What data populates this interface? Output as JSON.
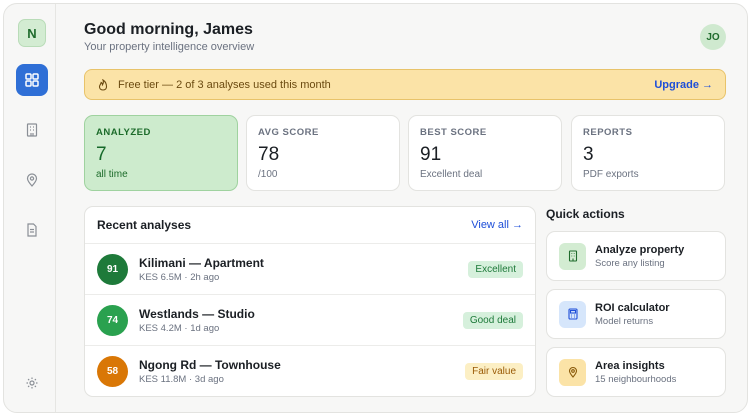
{
  "sidebar": {
    "logo_letter": "N",
    "items": [
      {
        "icon": "dashboard-icon",
        "active": true
      },
      {
        "icon": "building-icon",
        "active": false
      },
      {
        "icon": "map-pin-icon",
        "active": false
      },
      {
        "icon": "document-icon",
        "active": false
      }
    ],
    "settings_icon": "gear-icon"
  },
  "header": {
    "greeting": "Good morning, James",
    "subtitle": "Your property intelligence overview",
    "avatar_initials": "JO"
  },
  "banner": {
    "text": "Free tier — 2 of 3 analyses used this month",
    "action": "Upgrade →"
  },
  "stats": [
    {
      "label": "ANALYZED",
      "value": "7",
      "sub": "all time"
    },
    {
      "label": "AVG SCORE",
      "value": "78",
      "sub": "/100"
    },
    {
      "label": "BEST SCORE",
      "value": "91",
      "sub": "Excellent deal"
    },
    {
      "label": "REPORTS",
      "value": "3",
      "sub": "PDF exports"
    }
  ],
  "recent": {
    "title": "Recent analyses",
    "view_all": "View all →",
    "rows": [
      {
        "score": "91",
        "name": "Kilimani — Apartment",
        "meta": "KES 6.5M · 2h ago",
        "badge": "Excellent",
        "score_color": "#1e7a3a",
        "badge_bg": "#d6f0dc",
        "badge_fg": "#1e7a3a"
      },
      {
        "score": "74",
        "name": "Westlands — Studio",
        "meta": "KES 4.2M · 1d ago",
        "badge": "Good deal",
        "score_color": "#2aa14f",
        "badge_bg": "#d6f0dc",
        "badge_fg": "#1e7a3a"
      },
      {
        "score": "58",
        "name": "Ngong Rd — Townhouse",
        "meta": "KES 11.8M · 3d ago",
        "badge": "Fair value",
        "score_color": "#d97706",
        "badge_bg": "#fcefc4",
        "badge_fg": "#9a5b06"
      }
    ]
  },
  "quick_actions": {
    "title": "Quick actions",
    "items": [
      {
        "label": "Analyze property",
        "sub": "Score any listing",
        "icon": "building-icon",
        "icon_bg": "#d3ecd2",
        "icon_color": "#1f6b2c"
      },
      {
        "label": "ROI calculator",
        "sub": "Model returns",
        "icon": "calculator-icon",
        "icon_bg": "#d6e6fb",
        "icon_color": "#1d4ed8"
      },
      {
        "label": "Area insights",
        "sub": "15 neighbourhoods",
        "icon": "map-pin-icon",
        "icon_bg": "#fbe3a7",
        "icon_color": "#8a5a0a"
      }
    ]
  }
}
